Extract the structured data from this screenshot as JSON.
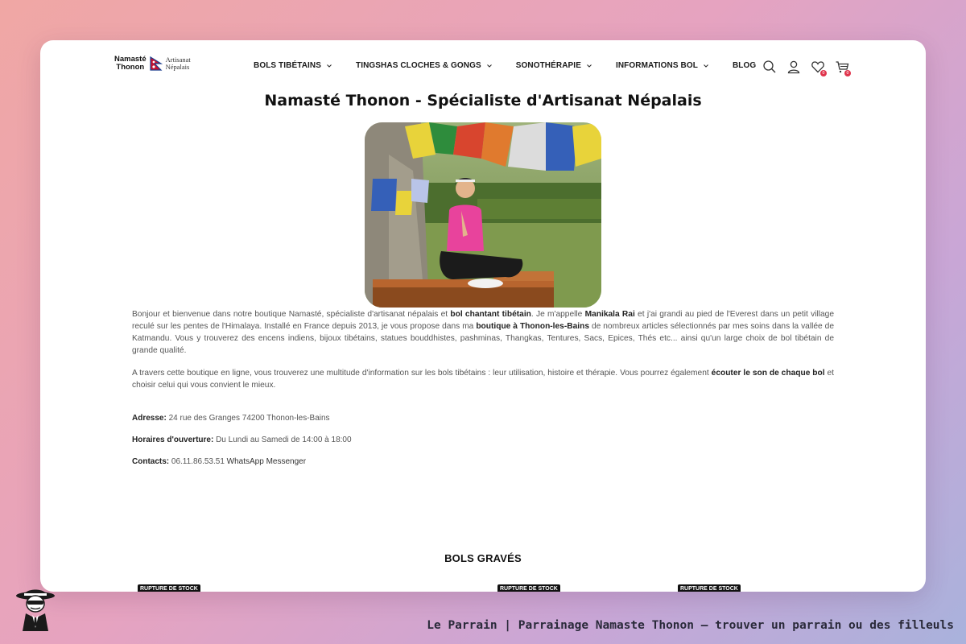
{
  "header": {
    "logo": {
      "line1": "Namasté",
      "line2": "Thonon",
      "sub1": "Artisanat",
      "sub2": "Népalais"
    },
    "nav": [
      {
        "label": "BOLS TIBÉTAINS",
        "dropdown": true
      },
      {
        "label": "TINGSHAS CLOCHES & GONGS",
        "dropdown": true
      },
      {
        "label": "SONOTHÉRAPIE",
        "dropdown": true
      },
      {
        "label": "INFORMATIONS BOL",
        "dropdown": true
      },
      {
        "label": "BLOG",
        "dropdown": false
      }
    ],
    "icons": [
      "search-icon",
      "account-icon",
      "wishlist-icon",
      "cart-icon"
    ],
    "wishlist_count": "0",
    "cart_count": "0"
  },
  "main": {
    "title": "Namasté Thonon - Spécialiste d'Artisanat Népalais",
    "intro": {
      "p1_a": "Bonjour et bienvenue dans notre boutique Namasté, spécialiste d'artisanat népalais et ",
      "p1_b": "bol chantant tibétain",
      "p1_c": ". Je m'appelle ",
      "p1_d": "Manikala Rai",
      "p1_e": " et j'ai grandi au pied de l'Everest dans un petit village reculé sur les pentes de l'Himalaya. Installé en France depuis 2013, je vous propose dans ma ",
      "p1_f": "boutique à Thonon-les-Bains",
      "p1_g": " de nombreux articles sélectionnés par mes soins dans la vallée de Katmandu. Vous y trouverez des encens indiens, bijoux tibétains, statues bouddhistes, pashminas, Thangkas, Tentures, Sacs, Epices, Thés etc... ainsi qu'un large choix de bol tibétain de grande qualité.",
      "p2_a": "A travers cette boutique en ligne, vous trouverez une multitude d'information sur les bols tibétains : leur utilisation, histoire et thérapie. Vous pourrez également ",
      "p2_b": "écouter le son de chaque bol",
      "p2_c": " et choisir celui qui vous convient le mieux."
    },
    "address_label": "Adresse:",
    "address_value": " 24 rue des Granges 74200 Thonon-les-Bains",
    "hours_label": "Horaires d'ouverture:",
    "hours_value": " Du Lundi au Samedi de 14:00 à 18:00",
    "contacts_label": "Contacts:",
    "contacts_phone": " 06.11.86.53.51 ",
    "contacts_link": "WhatsApp Messenger",
    "section_title": "BOLS GRAVÉS",
    "stock_tag": "RUPTURE DE STOCK"
  },
  "footer": {
    "caption": "Le Parrain | Parrainage Namaste Thonon — trouver un parrain ou des filleuls"
  },
  "colors": {
    "badge": "#e0344c",
    "text_dark": "#111111",
    "text_body": "#555555"
  }
}
